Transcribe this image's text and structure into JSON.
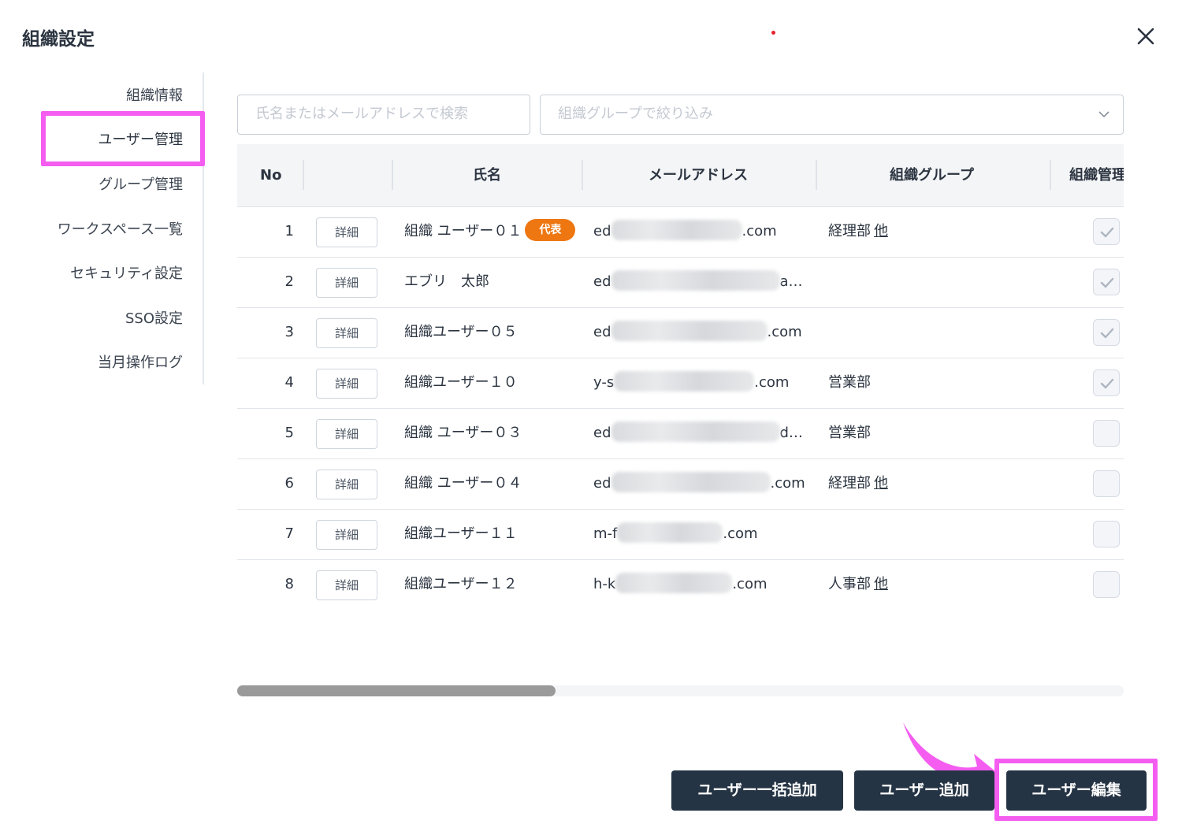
{
  "dialog": {
    "title": "組織設定",
    "close_icon": "close-icon"
  },
  "sidebar": {
    "items": [
      {
        "label": "組織情報"
      },
      {
        "label": "ユーザー管理",
        "active": true
      },
      {
        "label": "グループ管理"
      },
      {
        "label": "ワークスペース一覧"
      },
      {
        "label": "セキュリティ設定"
      },
      {
        "label": "SSO設定"
      },
      {
        "label": "当月操作ログ"
      }
    ]
  },
  "filters": {
    "search_placeholder": "氏名またはメールアドレスで検索",
    "group_placeholder": "組織グループで絞り込み"
  },
  "table": {
    "headers": {
      "no": "No",
      "name": "氏名",
      "email": "メールアドレス",
      "group": "組織グループ",
      "admin": "組織管理"
    },
    "detail_label": "詳細",
    "representative_badge": "代表",
    "other_label": "他",
    "rows": [
      {
        "no": "1",
        "name": "組織 ユーザー０１",
        "representative": true,
        "email_prefix": "ed",
        "email_suffix": ".com",
        "group": "経理部",
        "has_other": true,
        "admin": true
      },
      {
        "no": "2",
        "name": "エブリ　太郎",
        "representative": false,
        "email_prefix": "ed",
        "email_suffix": "a…",
        "group": "",
        "has_other": false,
        "admin": true
      },
      {
        "no": "3",
        "name": "組織ユーザー０５",
        "representative": false,
        "email_prefix": "ed",
        "email_suffix": ".com",
        "group": "",
        "has_other": false,
        "admin": true
      },
      {
        "no": "4",
        "name": "組織ユーザー１０",
        "representative": false,
        "email_prefix": "y-s",
        "email_suffix": ".com",
        "group": "営業部",
        "has_other": false,
        "admin": true
      },
      {
        "no": "5",
        "name": "組織 ユーザー０３",
        "representative": false,
        "email_prefix": "ed",
        "email_suffix": "d…",
        "group": "営業部",
        "has_other": false,
        "admin": false
      },
      {
        "no": "6",
        "name": "組織 ユーザー０４",
        "representative": false,
        "email_prefix": "ed",
        "email_suffix": ".com",
        "group": "経理部",
        "has_other": true,
        "admin": false
      },
      {
        "no": "7",
        "name": "組織ユーザー１１",
        "representative": false,
        "email_prefix": "m-f",
        "email_suffix": ".com",
        "group": "",
        "has_other": false,
        "admin": false
      },
      {
        "no": "8",
        "name": "組織ユーザー１２",
        "representative": false,
        "email_prefix": "h-k",
        "email_suffix": ".com",
        "group": "人事部",
        "has_other": true,
        "admin": false
      }
    ]
  },
  "footer": {
    "bulk_add_label": "ユーザー一括追加",
    "add_label": "ユーザー追加",
    "edit_label": "ユーザー編集"
  },
  "colors": {
    "primary_button": "#253444",
    "badge": "#ee7712",
    "highlight": "#f45df0"
  }
}
